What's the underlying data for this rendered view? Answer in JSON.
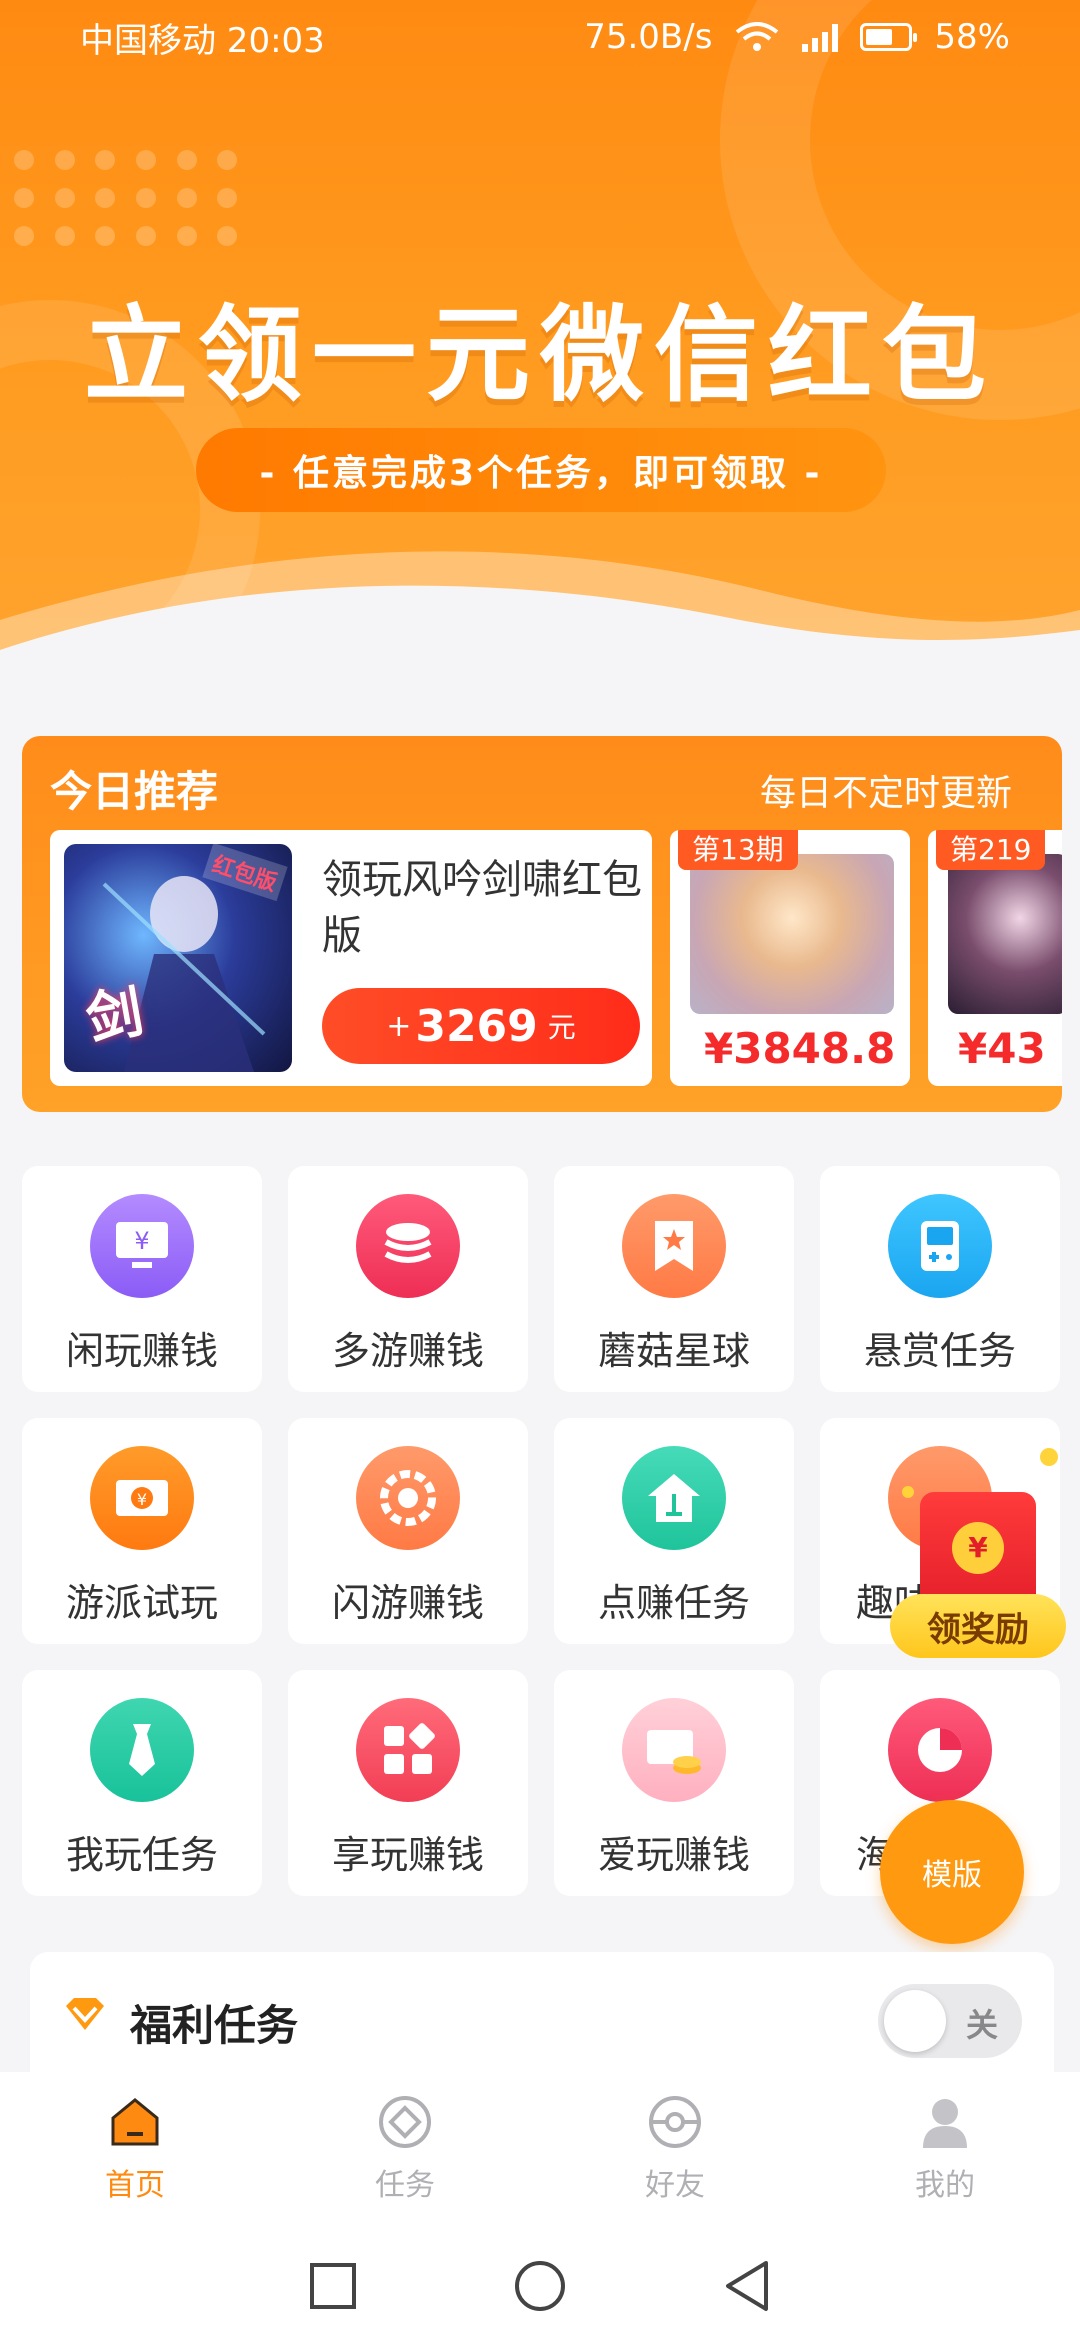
{
  "status_bar": {
    "carrier_time": "中国移动 20:03",
    "speed": "75.0B/s",
    "battery": "58%"
  },
  "banner": {
    "headline": "立领一元微信红包",
    "subtitle": "- 任意完成3个任务，即可领取 -"
  },
  "recommend": {
    "title": "今日推荐",
    "subtitle": "每日不定时更新",
    "featured": {
      "badge": "红包版",
      "art_text": "剑",
      "name": "领玩风吟剑啸红包版",
      "plus": "+",
      "amount": "3269",
      "unit": "元"
    },
    "items": [
      {
        "period": "第13期",
        "price": "¥3848.8"
      },
      {
        "period": "第219",
        "price": "¥43"
      }
    ]
  },
  "grid": [
    {
      "label": "闲玩赚钱",
      "icon": "monitor-yen-icon"
    },
    {
      "label": "多游赚钱",
      "icon": "stack-icon"
    },
    {
      "label": "蘑菇星球",
      "icon": "bookmark-star-icon"
    },
    {
      "label": "悬赏任务",
      "icon": "gamepad-icon"
    },
    {
      "label": "游派试玩",
      "icon": "banknote-icon"
    },
    {
      "label": "闪游赚钱",
      "icon": "flower-icon"
    },
    {
      "label": "点赚任务",
      "icon": "house-icon"
    },
    {
      "label": "趣味",
      "icon": "circle-icon"
    },
    {
      "label": "我玩任务",
      "icon": "tie-icon"
    },
    {
      "label": "享玩赚钱",
      "icon": "blocks-icon"
    },
    {
      "label": "爱玩赚钱",
      "icon": "coins-icon"
    },
    {
      "label": "海",
      "icon": "pie-icon"
    }
  ],
  "redpack": {
    "coin": "¥",
    "claim_label": "领奖励"
  },
  "template_button": "模版",
  "welfare": {
    "title": "福利任务",
    "toggle_label": "关"
  },
  "tabbar": [
    {
      "label": "首页",
      "active": true
    },
    {
      "label": "任务",
      "active": false
    },
    {
      "label": "好友",
      "active": false
    },
    {
      "label": "我的",
      "active": false
    }
  ],
  "colors": {
    "accent": "#ff8a12",
    "price_red": "#f52b2b",
    "background": "#f5f5f7"
  }
}
